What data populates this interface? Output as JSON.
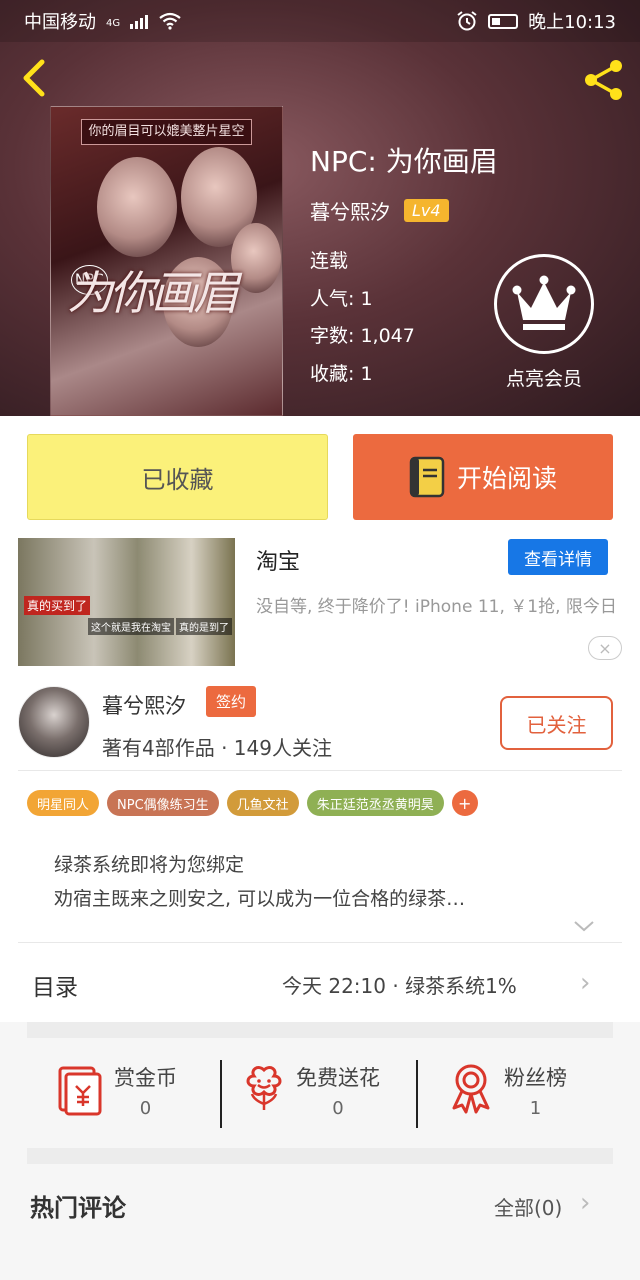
{
  "status_bar": {
    "carrier": "中国移动",
    "network": "4G",
    "time": "晚上10:13"
  },
  "header": {
    "back_icon": "back-chevron-icon",
    "share_icon": "share-icon",
    "accent_color": "#ffe11a"
  },
  "cover": {
    "banner": "你的眉目可以媲美整片星空",
    "art_title": "为你画眉",
    "npc_mark": "NPC"
  },
  "book": {
    "title": "NPC: 为你画眉",
    "author": "暮兮熙汐",
    "level": "Lv4",
    "status": "连载",
    "popularity": "人气: 1",
    "word_count": "字数: 1,047",
    "favorites": "收藏: 1"
  },
  "vip": {
    "icon": "crown-icon",
    "label": "点亮会员"
  },
  "actions": {
    "collected_label": "已收藏",
    "read_label": "开始阅读",
    "read_icon": "book-icon"
  },
  "ad": {
    "title": "淘宝",
    "button": "查看详情",
    "description": "没自等, 终于降价了! iPhone 11, ￥1抢, 限今日",
    "close": "×",
    "image_tags": [
      "真的买到了",
      "这个就是我在淘宝",
      "真的是到了"
    ]
  },
  "author": {
    "name": "暮兮熙汐",
    "signed_badge": "签约",
    "stats": "著有4部作品 · 149人关注",
    "follow_label": "已关注"
  },
  "tags": [
    {
      "label": "明星同人",
      "color": "#f2a535"
    },
    {
      "label": "NPC偶像练习生",
      "color": "#c87455"
    },
    {
      "label": "几鱼文社",
      "color": "#d29b3a"
    },
    {
      "label": "朱正廷范丞丞黄明昊",
      "color": "#8fb054"
    },
    {
      "label": "+",
      "color": "#ec6a3f"
    }
  ],
  "description": {
    "line1": "绿茶系统即将为您绑定",
    "line2": "劝宿主既来之则安之, 可以成为一位合格的绿茶…"
  },
  "catalog": {
    "label": "目录",
    "latest": "今天 22:10 · 绿茶系统1%"
  },
  "rewards": [
    {
      "label": "赏金币",
      "value": "0",
      "icon": "red-envelope-icon"
    },
    {
      "label": "免费送花",
      "value": "0",
      "icon": "flower-icon"
    },
    {
      "label": "粉丝榜",
      "value": "1",
      "icon": "ribbon-medal-icon"
    }
  ],
  "comments": {
    "label": "热门评论",
    "all_link": "全部(0)"
  }
}
